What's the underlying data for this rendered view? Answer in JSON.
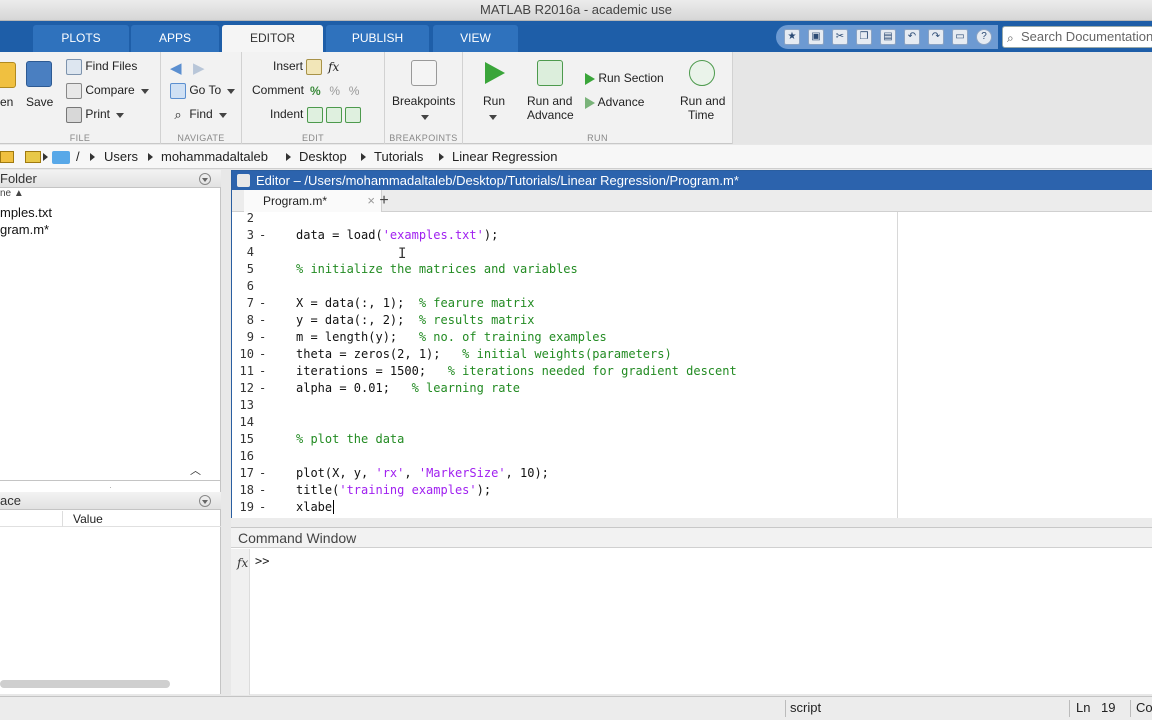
{
  "window": {
    "title": "MATLAB R2016a - academic use"
  },
  "ribbon": {
    "tabs": [
      {
        "label": "PLOTS"
      },
      {
        "label": "APPS"
      },
      {
        "label": "EDITOR"
      },
      {
        "label": "PUBLISH"
      },
      {
        "label": "VIEW"
      }
    ],
    "active_tab": "EDITOR",
    "search_placeholder": "Search Documentation"
  },
  "toolstrip": {
    "file": {
      "label": "FILE",
      "open": "en",
      "save": "Save",
      "find_files": "Find Files",
      "compare": "Compare",
      "print": "Print"
    },
    "navigate": {
      "label": "NAVIGATE",
      "go_to": "Go To",
      "find": "Find"
    },
    "edit": {
      "label": "EDIT",
      "insert": "Insert",
      "comment": "Comment",
      "indent": "Indent",
      "insert_fx": "fx"
    },
    "breakpoints": {
      "label": "BREAKPOINTS",
      "button": "Breakpoints"
    },
    "run": {
      "label": "RUN",
      "run": "Run",
      "run_and_advance_1": "Run and",
      "run_and_advance_2": "Advance",
      "run_section": "Run Section",
      "advance": "Advance",
      "run_and_time_1": "Run and",
      "run_and_time_2": "Time"
    }
  },
  "breadcrumb": {
    "root": "/",
    "parts": [
      "Users",
      "mohammadaltaleb",
      "Desktop",
      "Tutorials",
      "Linear Regression"
    ]
  },
  "left_pane": {
    "folder_header": "Folder",
    "column_header": "ne ▲",
    "files": [
      "mples.txt",
      "gram.m*"
    ],
    "workspace_header": "ace",
    "workspace_value_col": "Value"
  },
  "editor": {
    "title": "Editor – /Users/mohammadaltaleb/Desktop/Tutorials/Linear Regression/Program.m*",
    "tab_label": "Program.m*",
    "lines": [
      {
        "n": "2",
        "dash": "",
        "segs": []
      },
      {
        "n": "3",
        "dash": "-",
        "segs": [
          {
            "t": "data = load(",
            "c": ""
          },
          {
            "t": "'examples.txt'",
            "c": "str"
          },
          {
            "t": ");",
            "c": ""
          }
        ]
      },
      {
        "n": "4",
        "dash": "",
        "segs": []
      },
      {
        "n": "5",
        "dash": "",
        "segs": [
          {
            "t": "% initialize the matrices and variables",
            "c": "cmt"
          }
        ]
      },
      {
        "n": "6",
        "dash": "",
        "segs": []
      },
      {
        "n": "7",
        "dash": "-",
        "segs": [
          {
            "t": "X = data(:, 1);  ",
            "c": ""
          },
          {
            "t": "% fearure matrix",
            "c": "cmt"
          }
        ]
      },
      {
        "n": "8",
        "dash": "-",
        "segs": [
          {
            "t": "y = data(:, 2);  ",
            "c": ""
          },
          {
            "t": "% results matrix",
            "c": "cmt"
          }
        ]
      },
      {
        "n": "9",
        "dash": "-",
        "segs": [
          {
            "t": "m = length(y);   ",
            "c": ""
          },
          {
            "t": "% no. of training examples",
            "c": "cmt"
          }
        ]
      },
      {
        "n": "10",
        "dash": "-",
        "segs": [
          {
            "t": "theta = zeros(2, 1);   ",
            "c": ""
          },
          {
            "t": "% initial weights(parameters)",
            "c": "cmt"
          }
        ]
      },
      {
        "n": "11",
        "dash": "-",
        "segs": [
          {
            "t": "iterations = 1500;   ",
            "c": ""
          },
          {
            "t": "% iterations needed for gradient descent",
            "c": "cmt"
          }
        ]
      },
      {
        "n": "12",
        "dash": "-",
        "segs": [
          {
            "t": "alpha = 0.01;   ",
            "c": ""
          },
          {
            "t": "% learning rate",
            "c": "cmt"
          }
        ]
      },
      {
        "n": "13",
        "dash": "",
        "segs": []
      },
      {
        "n": "14",
        "dash": "",
        "segs": []
      },
      {
        "n": "15",
        "dash": "",
        "segs": [
          {
            "t": "% plot the data",
            "c": "cmt"
          }
        ]
      },
      {
        "n": "16",
        "dash": "",
        "segs": []
      },
      {
        "n": "17",
        "dash": "-",
        "segs": [
          {
            "t": "plot(X, y, ",
            "c": ""
          },
          {
            "t": "'rx'",
            "c": "str"
          },
          {
            "t": ", ",
            "c": ""
          },
          {
            "t": "'MarkerSize'",
            "c": "str"
          },
          {
            "t": ", 10);",
            "c": ""
          }
        ]
      },
      {
        "n": "18",
        "dash": "-",
        "segs": [
          {
            "t": "title(",
            "c": ""
          },
          {
            "t": "'training examples'",
            "c": "str"
          },
          {
            "t": ");",
            "c": ""
          }
        ]
      },
      {
        "n": "19",
        "dash": "-",
        "segs": [
          {
            "t": "xlabe",
            "c": ""
          }
        ]
      }
    ]
  },
  "command_window": {
    "header": "Command Window",
    "fx": "fx",
    "prompt": ">>"
  },
  "status": {
    "mode": "script",
    "ln_label": "Ln",
    "ln_value": "19",
    "col_label": "Co"
  },
  "colors": {
    "ribbon_blue": "#1e5ea8",
    "editor_title_blue": "#2c63ad",
    "string_purple": "#a020f0",
    "comment_green": "#228b22"
  }
}
